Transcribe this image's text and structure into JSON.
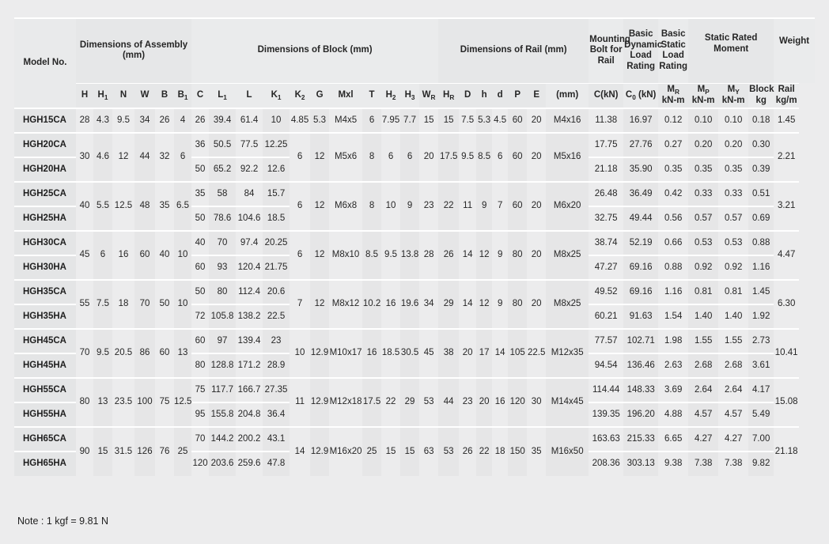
{
  "note": "Note : 1 kgf = 9.81 N",
  "header": {
    "model": "Model No.",
    "groups": {
      "assembly": "Dimensions of Assembly (mm)",
      "block": "Dimensions of Block (mm)",
      "rail": "Dimensions of Rail (mm)",
      "mounting_bolt": "Mounting Bolt for Rail",
      "basic_dynamic": "Basic Dynamic Load Rating",
      "basic_static": "Basic Static Load Rating",
      "static_moment": "Static Rated Moment",
      "weight": "Weight"
    },
    "symbols": {
      "H": "H",
      "H1": "H",
      "H1sub": "1",
      "N": "N",
      "W": "W",
      "B": "B",
      "B1": "B",
      "B1sub": "1",
      "C": "C",
      "L1": "L",
      "L1sub": "1",
      "L": "L",
      "K1": "K",
      "K1sub": "1",
      "K2": "K",
      "K2sub": "2",
      "G": "G",
      "Mxl": "Mxl",
      "T": "T",
      "H2": "H",
      "H2sub": "2",
      "H3": "H",
      "H3sub": "3",
      "WR": "W",
      "WRsub": "R",
      "HR": "H",
      "HRsub": "R",
      "D": "D",
      "h": "h",
      "d": "d",
      "P": "P",
      "E": "E",
      "bolt_unit": "(mm)",
      "C_kN": "C(kN)",
      "C0_kN": "C",
      "C0sub": "0",
      "C0_unit": " (kN)",
      "MR": "M",
      "MRsub": "R",
      "MP": "M",
      "MPsub": "P",
      "MY": "M",
      "MYsub": "Y",
      "MR_unit": "kN-m",
      "MP_unit": "kN-m",
      "MY_unit": "kN-m",
      "block": "Block",
      "rail": "Rail",
      "kg": "kg",
      "kgm": "kg/m"
    }
  },
  "colors": {
    "header_text": "#2a5d80",
    "page_bg": "#ececed",
    "col_stripe": "#e6e6e7",
    "separator": "#ffffff"
  },
  "groups": [
    {
      "id": "hgh15",
      "models": [
        "HGH15CA"
      ],
      "assembly": {
        "H": "28",
        "H1": "4.3",
        "N": "9.5",
        "W": "34",
        "B": "26",
        "B1": "4"
      },
      "block_per_model": [
        {
          "C": "26",
          "L1": "39.4",
          "L": "61.4",
          "K1": "10"
        }
      ],
      "block_shared": {
        "K2": "4.85",
        "G": "5.3",
        "Mxl": "M4x5",
        "T": "6",
        "H2": "7.95",
        "H3": "7.7"
      },
      "rail": {
        "WR": "15",
        "HR": "15",
        "D": "7.5",
        "h": "5.3",
        "d": "4.5",
        "P": "60",
        "E": "20"
      },
      "bolt": "M4x16",
      "ratings_per_model": [
        {
          "C": "11.38",
          "C0": "16.97",
          "MR": "0.12",
          "MP": "0.10",
          "MY": "0.10",
          "block_kg": "0.18"
        }
      ],
      "rail_kgm": "1.45"
    },
    {
      "id": "hgh20",
      "models": [
        "HGH20CA",
        "HGH20HA"
      ],
      "assembly": {
        "H": "30",
        "H1": "4.6",
        "N": "12",
        "W": "44",
        "B": "32",
        "B1": "6"
      },
      "block_per_model": [
        {
          "C": "36",
          "L1": "50.5",
          "L": "77.5",
          "K1": "12.25"
        },
        {
          "C": "50",
          "L1": "65.2",
          "L": "92.2",
          "K1": "12.6"
        }
      ],
      "block_shared": {
        "K2": "6",
        "G": "12",
        "Mxl": "M5x6",
        "T": "8",
        "H2": "6",
        "H3": "6"
      },
      "rail": {
        "WR": "20",
        "HR": "17.5",
        "D": "9.5",
        "h": "8.5",
        "d": "6",
        "P": "60",
        "E": "20"
      },
      "bolt": "M5x16",
      "ratings_per_model": [
        {
          "C": "17.75",
          "C0": "27.76",
          "MR": "0.27",
          "MP": "0.20",
          "MY": "0.20",
          "block_kg": "0.30"
        },
        {
          "C": "21.18",
          "C0": "35.90",
          "MR": "0.35",
          "MP": "0.35",
          "MY": "0.35",
          "block_kg": "0.39"
        }
      ],
      "rail_kgm": "2.21"
    },
    {
      "id": "hgh25",
      "models": [
        "HGH25CA",
        "HGH25HA"
      ],
      "assembly": {
        "H": "40",
        "H1": "5.5",
        "N": "12.5",
        "W": "48",
        "B": "35",
        "B1": "6.5"
      },
      "block_per_model": [
        {
          "C": "35",
          "L1": "58",
          "L": "84",
          "K1": "15.7"
        },
        {
          "C": "50",
          "L1": "78.6",
          "L": "104.6",
          "K1": "18.5"
        }
      ],
      "block_shared": {
        "K2": "6",
        "G": "12",
        "Mxl": "M6x8",
        "T": "8",
        "H2": "10",
        "H3": "9"
      },
      "rail": {
        "WR": "23",
        "HR": "22",
        "D": "11",
        "h": "9",
        "d": "7",
        "P": "60",
        "E": "20"
      },
      "bolt": "M6x20",
      "ratings_per_model": [
        {
          "C": "26.48",
          "C0": "36.49",
          "MR": "0.42",
          "MP": "0.33",
          "MY": "0.33",
          "block_kg": "0.51"
        },
        {
          "C": "32.75",
          "C0": "49.44",
          "MR": "0.56",
          "MP": "0.57",
          "MY": "0.57",
          "block_kg": "0.69"
        }
      ],
      "rail_kgm": "3.21"
    },
    {
      "id": "hgh30",
      "models": [
        "HGH30CA",
        "HGH30HA"
      ],
      "assembly": {
        "H": "45",
        "H1": "6",
        "N": "16",
        "W": "60",
        "B": "40",
        "B1": "10"
      },
      "block_per_model": [
        {
          "C": "40",
          "L1": "70",
          "L": "97.4",
          "K1": "20.25"
        },
        {
          "C": "60",
          "L1": "93",
          "L": "120.4",
          "K1": "21.75"
        }
      ],
      "block_shared": {
        "K2": "6",
        "G": "12",
        "Mxl": "M8x10",
        "T": "8.5",
        "H2": "9.5",
        "H3": "13.8"
      },
      "rail": {
        "WR": "28",
        "HR": "26",
        "D": "14",
        "h": "12",
        "d": "9",
        "P": "80",
        "E": "20"
      },
      "bolt": "M8x25",
      "ratings_per_model": [
        {
          "C": "38.74",
          "C0": "52.19",
          "MR": "0.66",
          "MP": "0.53",
          "MY": "0.53",
          "block_kg": "0.88"
        },
        {
          "C": "47.27",
          "C0": "69.16",
          "MR": "0.88",
          "MP": "0.92",
          "MY": "0.92",
          "block_kg": "1.16"
        }
      ],
      "rail_kgm": "4.47"
    },
    {
      "id": "hgh35",
      "models": [
        "HGH35CA",
        "HGH35HA"
      ],
      "assembly": {
        "H": "55",
        "H1": "7.5",
        "N": "18",
        "W": "70",
        "B": "50",
        "B1": "10"
      },
      "block_per_model": [
        {
          "C": "50",
          "L1": "80",
          "L": "112.4",
          "K1": "20.6"
        },
        {
          "C": "72",
          "L1": "105.8",
          "L": "138.2",
          "K1": "22.5"
        }
      ],
      "block_shared": {
        "K2": "7",
        "G": "12",
        "Mxl": "M8x12",
        "T": "10.2",
        "H2": "16",
        "H3": "19.6"
      },
      "rail": {
        "WR": "34",
        "HR": "29",
        "D": "14",
        "h": "12",
        "d": "9",
        "P": "80",
        "E": "20"
      },
      "bolt": "M8x25",
      "ratings_per_model": [
        {
          "C": "49.52",
          "C0": "69.16",
          "MR": "1.16",
          "MP": "0.81",
          "MY": "0.81",
          "block_kg": "1.45"
        },
        {
          "C": "60.21",
          "C0": "91.63",
          "MR": "1.54",
          "MP": "1.40",
          "MY": "1.40",
          "block_kg": "1.92"
        }
      ],
      "rail_kgm": "6.30"
    },
    {
      "id": "hgh45",
      "models": [
        "HGH45CA",
        "HGH45HA"
      ],
      "assembly": {
        "H": "70",
        "H1": "9.5",
        "N": "20.5",
        "W": "86",
        "B": "60",
        "B1": "13"
      },
      "block_per_model": [
        {
          "C": "60",
          "L1": "97",
          "L": "139.4",
          "K1": "23"
        },
        {
          "C": "80",
          "L1": "128.8",
          "L": "171.2",
          "K1": "28.9"
        }
      ],
      "block_shared": {
        "K2": "10",
        "G": "12.9",
        "Mxl": "M10x17",
        "T": "16",
        "H2": "18.5",
        "H3": "30.5"
      },
      "rail": {
        "WR": "45",
        "HR": "38",
        "D": "20",
        "h": "17",
        "d": "14",
        "P": "105",
        "E": "22.5"
      },
      "bolt": "M12x35",
      "ratings_per_model": [
        {
          "C": "77.57",
          "C0": "102.71",
          "MR": "1.98",
          "MP": "1.55",
          "MY": "1.55",
          "block_kg": "2.73"
        },
        {
          "C": "94.54",
          "C0": "136.46",
          "MR": "2.63",
          "MP": "2.68",
          "MY": "2.68",
          "block_kg": "3.61"
        }
      ],
      "rail_kgm": "10.41"
    },
    {
      "id": "hgh55",
      "models": [
        "HGH55CA",
        "HGH55HA"
      ],
      "assembly": {
        "H": "80",
        "H1": "13",
        "N": "23.5",
        "W": "100",
        "B": "75",
        "B1": "12.5"
      },
      "block_per_model": [
        {
          "C": "75",
          "L1": "117.7",
          "L": "166.7",
          "K1": "27.35"
        },
        {
          "C": "95",
          "L1": "155.8",
          "L": "204.8",
          "K1": "36.4"
        }
      ],
      "block_shared": {
        "K2": "11",
        "G": "12.9",
        "Mxl": "M12x18",
        "T": "17.5",
        "H2": "22",
        "H3": "29"
      },
      "rail": {
        "WR": "53",
        "HR": "44",
        "D": "23",
        "h": "20",
        "d": "16",
        "P": "120",
        "E": "30"
      },
      "bolt": "M14x45",
      "ratings_per_model": [
        {
          "C": "114.44",
          "C0": "148.33",
          "MR": "3.69",
          "MP": "2.64",
          "MY": "2.64",
          "block_kg": "4.17"
        },
        {
          "C": "139.35",
          "C0": "196.20",
          "MR": "4.88",
          "MP": "4.57",
          "MY": "4.57",
          "block_kg": "5.49"
        }
      ],
      "rail_kgm": "15.08"
    },
    {
      "id": "hgh65",
      "models": [
        "HGH65CA",
        "HGH65HA"
      ],
      "assembly": {
        "H": "90",
        "H1": "15",
        "N": "31.5",
        "W": "126",
        "B": "76",
        "B1": "25"
      },
      "block_per_model": [
        {
          "C": "70",
          "L1": "144.2",
          "L": "200.2",
          "K1": "43.1"
        },
        {
          "C": "120",
          "L1": "203.6",
          "L": "259.6",
          "K1": "47.8"
        }
      ],
      "block_shared": {
        "K2": "14",
        "G": "12.9",
        "Mxl": "M16x20",
        "T": "25",
        "H2": "15",
        "H3": "15"
      },
      "rail": {
        "WR": "63",
        "HR": "53",
        "D": "26",
        "h": "22",
        "d": "18",
        "P": "150",
        "E": "35"
      },
      "bolt": "M16x50",
      "ratings_per_model": [
        {
          "C": "163.63",
          "C0": "215.33",
          "MR": "6.65",
          "MP": "4.27",
          "MY": "4.27",
          "block_kg": "7.00"
        },
        {
          "C": "208.36",
          "C0": "303.13",
          "MR": "9.38",
          "MP": "7.38",
          "MY": "7.38",
          "block_kg": "9.82"
        }
      ],
      "rail_kgm": "21.18"
    }
  ]
}
